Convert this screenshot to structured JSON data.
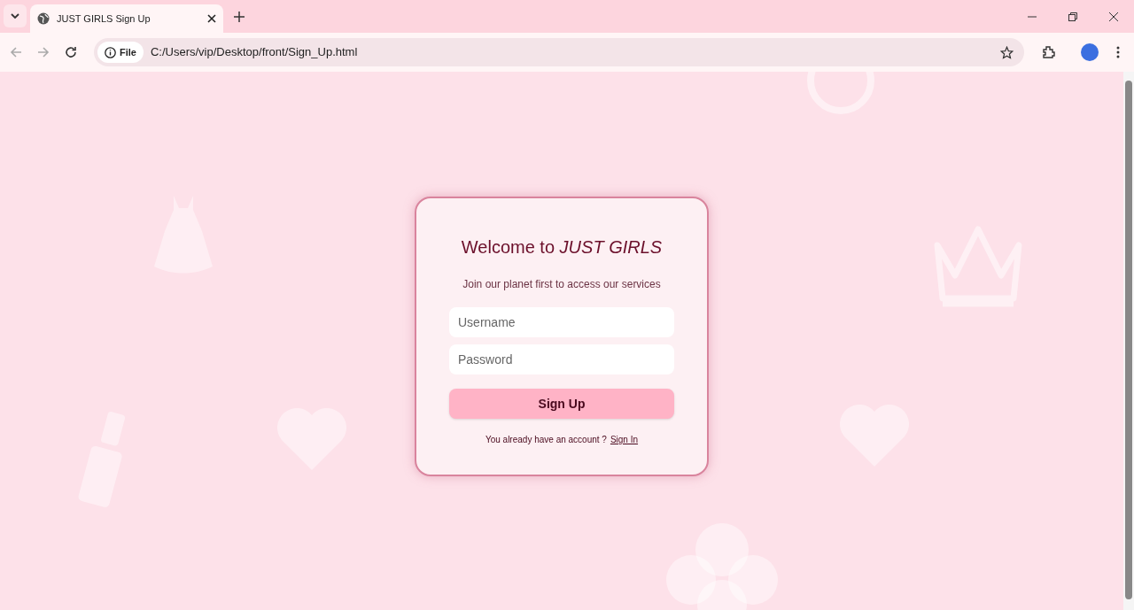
{
  "browser": {
    "tab": {
      "title": "JUST GIRLS Sign Up",
      "selected": true
    },
    "address": {
      "badge": "File",
      "url": "C:/Users/vip/Desktop/front/Sign_Up.html"
    }
  },
  "card": {
    "title": "Welcome to *JUST GIRLS*",
    "subtitle": "Join our planet first to access our services",
    "fields": [
      {
        "placeholder": "Username"
      },
      {
        "placeholder": "Password"
      }
    ],
    "button": "Sign Up",
    "prompt": "You already have an account ?",
    "link": "Sign In"
  }
}
